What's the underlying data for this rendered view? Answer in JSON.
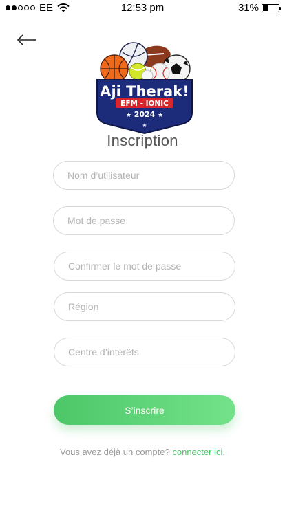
{
  "status_bar": {
    "carrier": "EE",
    "time": "12:53 pm",
    "battery_text": "31%",
    "battery_level": 0.31,
    "signal_filled": 2,
    "signal_total": 5
  },
  "header": {
    "back_icon": "arrow-left-icon"
  },
  "logo": {
    "line1": "Aji Therak!",
    "line2": "EFM - IONIC",
    "line3": "2024"
  },
  "page_title": "Inscription",
  "form": {
    "username_placeholder": "Nom d’utilisateur",
    "password_placeholder": "Mot de passe",
    "confirm_password_placeholder": "Confirmer le mot de passe",
    "region_placeholder": "Région",
    "interests_placeholder": "Centre d’intérêts",
    "submit_label": "S’inscrire"
  },
  "footer": {
    "prompt": "Vous avez déjà un compte? ",
    "link_label": "connecter ici",
    "suffix": "."
  },
  "colors": {
    "accent": "#4cc768",
    "logo_navy": "#1c2b7a",
    "logo_red": "#d9262c"
  }
}
